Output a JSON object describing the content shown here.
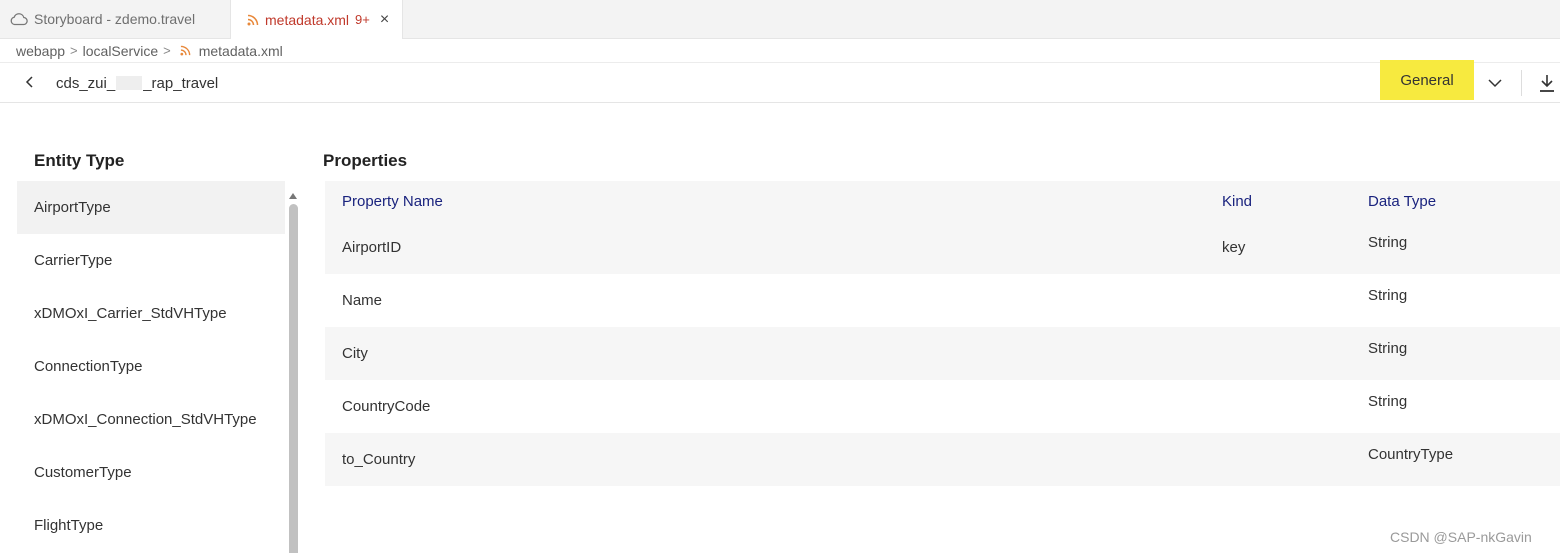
{
  "tabs": [
    {
      "label": "Storyboard - zdemo.travel",
      "icon": "cloud-icon",
      "active": false
    },
    {
      "label": "metadata.xml",
      "icon": "rss-icon",
      "badge": "9+",
      "active": true,
      "close": "×"
    }
  ],
  "breadcrumb": {
    "items": [
      "webapp",
      "localService",
      "metadata.xml"
    ],
    "separator": ">"
  },
  "header": {
    "title_prefix": "cds_zui_",
    "title_suffix": "_rap_travel",
    "view_button": "General"
  },
  "entity_panel": {
    "title": "Entity Type",
    "items": [
      "AirportType",
      "CarrierType",
      "xDMOxI_Carrier_StdVHType",
      "ConnectionType",
      "xDMOxI_Connection_StdVHType",
      "CustomerType",
      "FlightType"
    ],
    "selected_index": 0
  },
  "properties": {
    "title": "Properties",
    "columns": [
      "Property Name",
      "Kind",
      "Data Type"
    ],
    "rows": [
      {
        "name": "AirportID",
        "kind": "key",
        "type": "String"
      },
      {
        "name": "Name",
        "kind": "",
        "type": "String"
      },
      {
        "name": "City",
        "kind": "",
        "type": "String"
      },
      {
        "name": "CountryCode",
        "kind": "",
        "type": "String"
      },
      {
        "name": "to_Country",
        "kind": "",
        "type": "CountryType"
      }
    ]
  },
  "watermark": "CSDN @SAP-nkGavin",
  "colors": {
    "accent_button": "#f7ea3f",
    "column_header": "#1a237e",
    "tab_active_text": "#c0392b",
    "rss_icon": "#e8883a"
  }
}
